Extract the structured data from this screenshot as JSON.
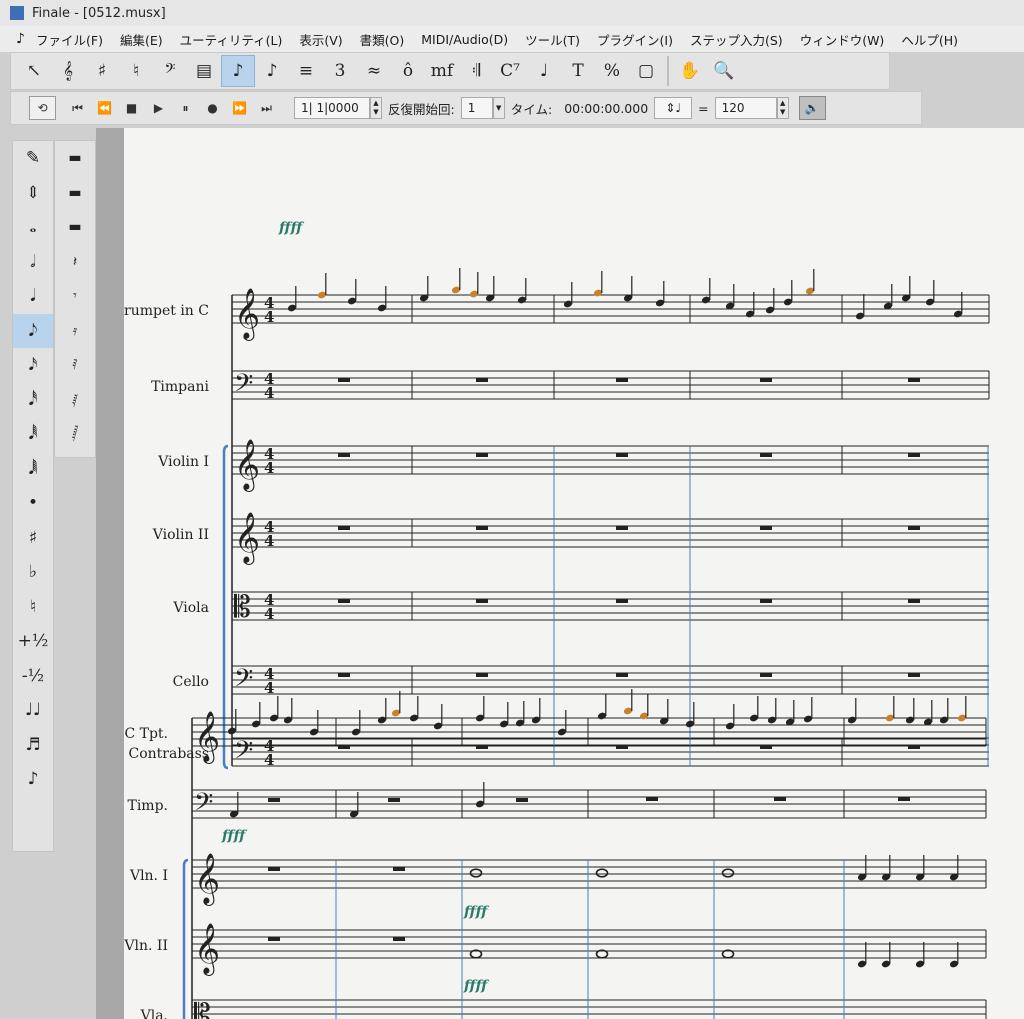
{
  "window": {
    "title": "Finale - [0512.musx]"
  },
  "menu": [
    "ファイル(F)",
    "編集(E)",
    "ユーティリティ(L)",
    "表示(V)",
    "書類(O)",
    "MIDI/Audio(D)",
    "ツール(T)",
    "プラグイン(I)",
    "ステップ入力(S)",
    "ウィンドウ(W)",
    "ヘルプ(H)"
  ],
  "toolbar": {
    "tools": [
      {
        "name": "selection-tool",
        "glyph": "↖"
      },
      {
        "name": "clef-tool",
        "glyph": "𝄞"
      },
      {
        "name": "key-signature-tool",
        "glyph": "♯"
      },
      {
        "name": "time-signature-tool",
        "glyph": "♮"
      },
      {
        "name": "bass-clef-tool",
        "glyph": "𝄢"
      },
      {
        "name": "measure-tool",
        "glyph": "▤"
      },
      {
        "name": "simple-entry-tool",
        "glyph": "♪"
      },
      {
        "name": "speedy-entry-tool",
        "glyph": "♪"
      },
      {
        "name": "hyperscribe-tool",
        "glyph": "≡"
      },
      {
        "name": "tuplet-tool",
        "glyph": "3"
      },
      {
        "name": "smart-shape-tool",
        "glyph": "≈"
      },
      {
        "name": "articulation-tool",
        "glyph": "ô"
      },
      {
        "name": "expression-tool",
        "glyph": "mf"
      },
      {
        "name": "repeat-tool",
        "glyph": "𝄇"
      },
      {
        "name": "chord-tool",
        "glyph": "C⁷"
      },
      {
        "name": "lyrics-tool",
        "glyph": "♩"
      },
      {
        "name": "text-tool",
        "glyph": "T"
      },
      {
        "name": "resize-tool",
        "glyph": "%"
      },
      {
        "name": "page-layout-tool",
        "glyph": "▢"
      },
      {
        "name": "hand-grabber-tool",
        "glyph": "✋"
      },
      {
        "name": "zoom-tool",
        "glyph": "🔍"
      }
    ]
  },
  "playback": {
    "position": "1| 1|0000",
    "repeat_label": "反復開始回:",
    "repeat_value": "1",
    "time_label": "タイム:",
    "time_value": "00:00:00.000",
    "equals": "=",
    "tempo": "120"
  },
  "palette": {
    "main": [
      "✎",
      "⇕",
      "𝅝",
      "𝅗𝅥",
      "𝅘𝅥",
      "𝅘𝅥𝅮",
      "𝅘𝅥𝅯",
      "𝅘𝅥𝅰",
      "𝅘𝅥𝅱",
      "𝅘𝅥𝅲",
      "•",
      "♯",
      "♭",
      "♮",
      "+½",
      "-½",
      "♩♩",
      "♬",
      "♪"
    ],
    "rests": [
      "▬",
      "▬",
      "▬",
      "𝄽",
      "𝄾",
      "𝄿",
      "𝅀",
      "𝅁",
      "𝅂"
    ]
  },
  "score": {
    "system1": [
      "Trumpet in C",
      "Timpani",
      "Violin I",
      "Violin II",
      "Viola",
      "Cello",
      "Contrabass"
    ],
    "system2": [
      "C Tpt.",
      "Timp.",
      "Vln. I",
      "Vln. II",
      "Vla."
    ],
    "dynamic": "ffff"
  }
}
